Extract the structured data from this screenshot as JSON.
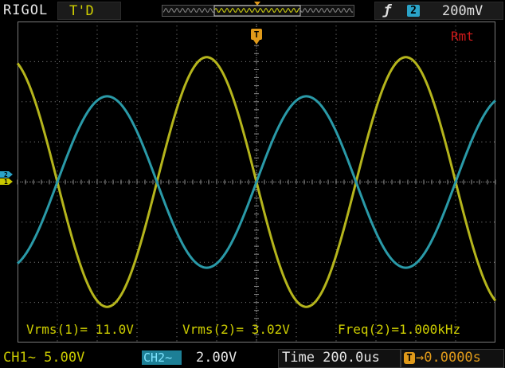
{
  "header": {
    "brand": "RIGOL",
    "status": "T'D",
    "trigger_edge_icon": "rising-edge-icon",
    "trigger_source": "2",
    "trigger_level": "200mV"
  },
  "indicators": {
    "remote": "Rmt"
  },
  "measurements": {
    "vrms1": "Vrms(1)= 11.0V",
    "vrms2": "Vrms(2)= 3.02V",
    "freq2": "Freq(2)=1.000kHz"
  },
  "footer": {
    "ch1": "CH1~  5.00V",
    "ch2_label": "CH2~",
    "ch2_value": "2.00V",
    "time": "Time 200.0us",
    "trigger_offset": "0.0000s"
  },
  "colors": {
    "ch1": "#b5b51c",
    "ch2": "#2a9aa8",
    "grid": "#8a8a8a",
    "trigger": "#e09a1a",
    "remote": "#d01a1a"
  },
  "waveforms": {
    "ch1": {
      "vrms": 11.0,
      "vertical_scale_v_per_div": 5.0,
      "frequency_hz": 1000,
      "phase_deg": 180
    },
    "ch2": {
      "vrms": 3.02,
      "vertical_scale_v_per_div": 2.0,
      "frequency_hz": 1000,
      "phase_deg": 0
    },
    "time_scale_s_per_div": 0.0002
  }
}
